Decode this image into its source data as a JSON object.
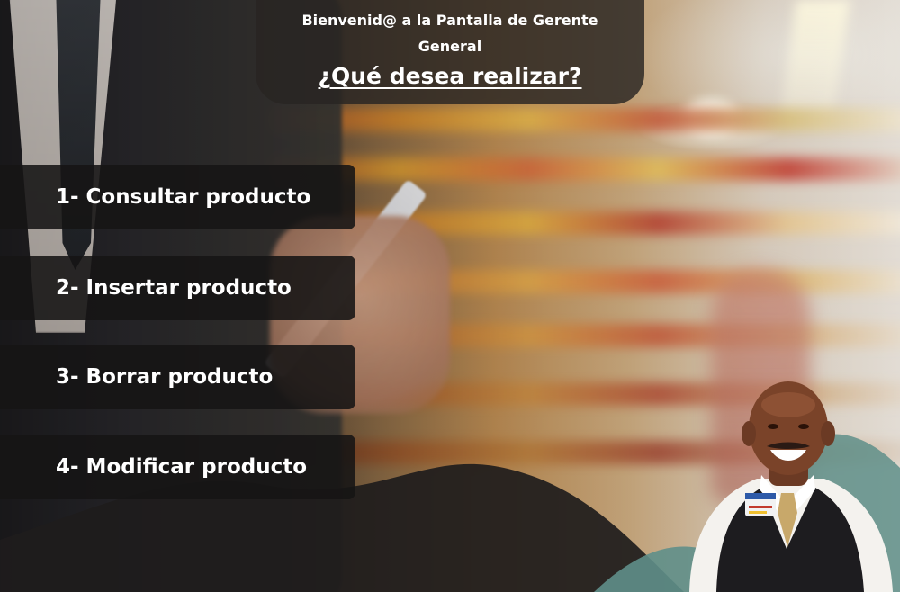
{
  "header": {
    "welcome_text": "Bienvenid@ a la Pantalla de Gerente General",
    "question": "¿Qué desea realizar?"
  },
  "menu": {
    "items": [
      {
        "label": "1- Consultar producto"
      },
      {
        "label": "2- Insertar producto"
      },
      {
        "label": "3- Borrar producto"
      },
      {
        "label": "4- Modificar producto"
      }
    ]
  },
  "colors": {
    "button_background": "#161414",
    "header_background": "#282422",
    "text": "#ffffff",
    "wave_teal": "#5f8f8a"
  }
}
